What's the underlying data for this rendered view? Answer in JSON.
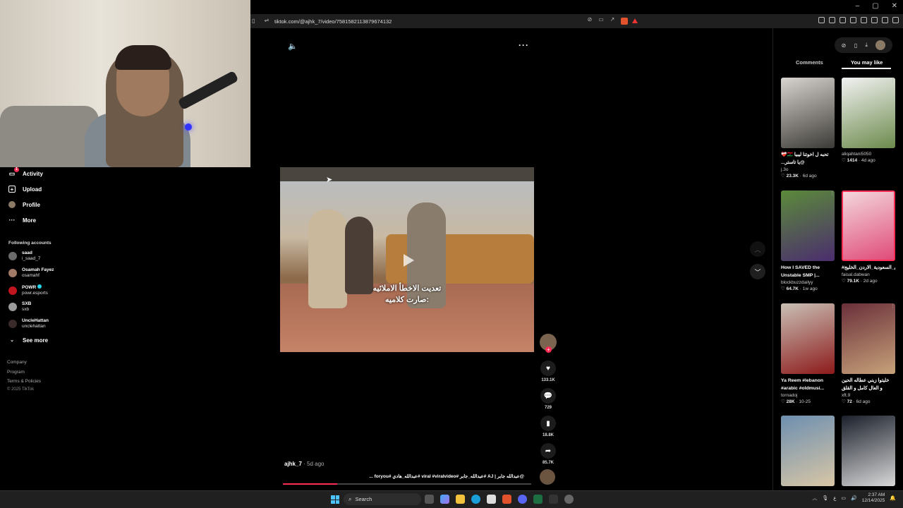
{
  "browser": {
    "url": "tiktok.com/@ajhk_7/video/7581582113879674132",
    "window_controls": [
      "–",
      "▢",
      "✕"
    ]
  },
  "sidebar": {
    "nav": [
      {
        "label": "Activity",
        "icon": "activity-icon",
        "badge": "1"
      },
      {
        "label": "Upload",
        "icon": "upload-icon"
      },
      {
        "label": "Profile",
        "icon": "profile-avatar"
      },
      {
        "label": "More",
        "icon": "more-dots-icon"
      }
    ],
    "following_title": "Following accounts",
    "accounts": [
      {
        "name": "saad",
        "handle": "i_saad_7"
      },
      {
        "name": "Osamah Fayez",
        "handle": "osamahf"
      },
      {
        "name": "POWR",
        "handle": "powr.esports",
        "verified": true
      },
      {
        "name": "SXB",
        "handle": "sxb"
      },
      {
        "name": "UncleHattan",
        "handle": "unclehattan"
      }
    ],
    "see_more": "See more",
    "footer": [
      "Company",
      "Program",
      "Terms & Policies",
      "© 2025 TikTok"
    ]
  },
  "video": {
    "caption_line1": "تعديت الاخطأ الاملائيه",
    "caption_line2": "صارت كلاميه:",
    "author": "ajhk_7",
    "posted": "· 5d ago",
    "description": "@عبدالله جابر | AJ #عبدالله_جابر #viral #viralvideo #عبدالله_هادي #foryou ...",
    "progress": 0.22
  },
  "actions": {
    "likes": "133.1K",
    "comments": "729",
    "saves": "18.8K",
    "shares": "85.7K"
  },
  "right_panel": {
    "tabs": [
      "Comments",
      "You may like"
    ],
    "active_tab": "You may like",
    "cards": [
      {
        "title": "‫تحبه ل اخوتنا ليبيا 🇱🇾❤️‍🩹 @يا تاستر...‬",
        "user": "j.3o",
        "likes": "23.3K",
        "age": "6d ago",
        "colors": [
          "#d8d4cf",
          "#3c3a36"
        ]
      },
      {
        "title": "",
        "user": "aliqahtani5050",
        "likes": "1414",
        "age": "4d ago",
        "colors": [
          "#f2f2f2",
          "#6c8a4c"
        ]
      },
      {
        "title": "How I SAVED the Unstable SMP |...",
        "user": "blockbuzzdailyy",
        "likes": "64.7K",
        "age": "1w ago",
        "colors": [
          "#5b8a3a",
          "#4b2d6e"
        ]
      },
      {
        "title": "#العراق_السعودية_الاردن_الخليج",
        "user": "faisal.dabwan",
        "likes": "79.1K",
        "age": "2d ago",
        "colors": [
          "#f3d7dc",
          "#e04b7a"
        ]
      },
      {
        "title": "Ya Reem #lebanon #arabic #oldmusi...",
        "user": "tornadoj",
        "likes": "28K",
        "age": "10-25",
        "colors": [
          "#c9c0b6",
          "#8c1a1a"
        ]
      },
      {
        "title": "خليتوا زبني عطاله الحين و العال كامل و القلق فيه...",
        "user": "xft.9",
        "likes": "72",
        "age": "6d ago",
        "colors": [
          "#6a2f3a",
          "#c7a27a"
        ]
      },
      {
        "title": "",
        "user": "",
        "likes": "",
        "age": "",
        "colors": [
          "#6d8fb0",
          "#d8c6a6"
        ]
      },
      {
        "title": "",
        "user": "",
        "likes": "",
        "age": "",
        "colors": [
          "#1a1f2a",
          "#d9d9d9"
        ]
      }
    ]
  },
  "taskbar": {
    "search": "Search",
    "time": "2:37 AM",
    "date": "12/14/2025"
  },
  "colors": {
    "accent": "#fe2c55",
    "windows_blue": "#4cc2ff"
  }
}
